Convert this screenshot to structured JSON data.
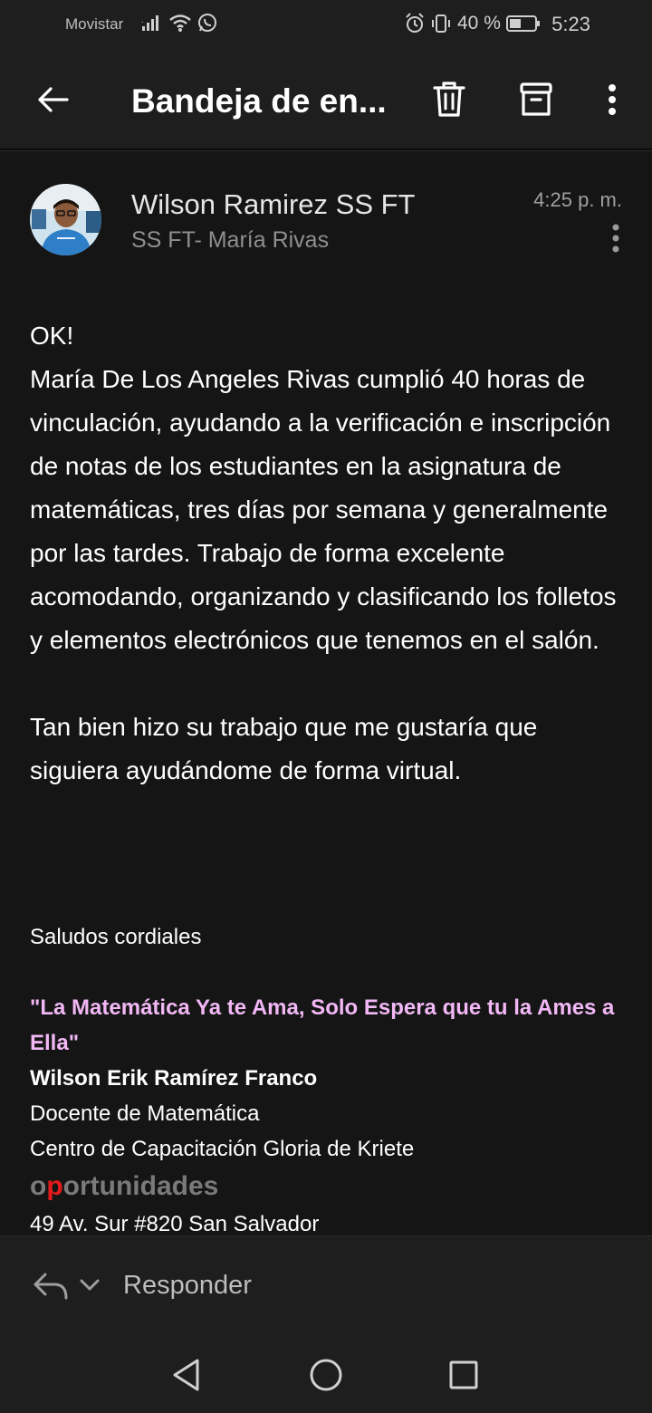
{
  "status_bar": {
    "carrier": "Movistar",
    "battery": "40 %",
    "time": "5:23"
  },
  "app_bar": {
    "title": "Bandeja de en..."
  },
  "message": {
    "sender": "Wilson Ramirez SS FT",
    "recipient": "SS FT- María Rivas",
    "time": "4:25 p. m.",
    "body_paragraph_1": "OK!\nMaría De Los Angeles Rivas cumplió 40 horas de vinculación, ayudando a la verificación e inscripción de notas de los estudiantes en la asignatura de matemáticas, tres días por semana y generalmente por las tardes. Trabajo de forma excelente acomodando, organizando y clasificando los folletos y elementos electrónicos que tenemos en el salón.",
    "body_paragraph_2": "Tan bien hizo su trabajo que me gustaría que siguiera ayudándome de forma virtual.",
    "greeting": "Saludos cordiales",
    "signature": {
      "quote": "\"La Matemática Ya te Ama, Solo Espera que tu la Ames a Ella\"",
      "name": "Wilson Erik Ramírez Franco",
      "role": "Docente de Matemática",
      "org": "Centro de Capacitación Gloria de Kriete",
      "brand_o": "o",
      "brand_p": "p",
      "brand_rest": "ortunidades",
      "address": "49 Av. Sur #820 San Salvador"
    }
  },
  "reply_bar": {
    "label": "Responder"
  },
  "colors": {
    "background": "#1e1e1e",
    "message_background": "#151515",
    "quote": "#f2b8f5",
    "brand_accent": "#e31b1b"
  }
}
